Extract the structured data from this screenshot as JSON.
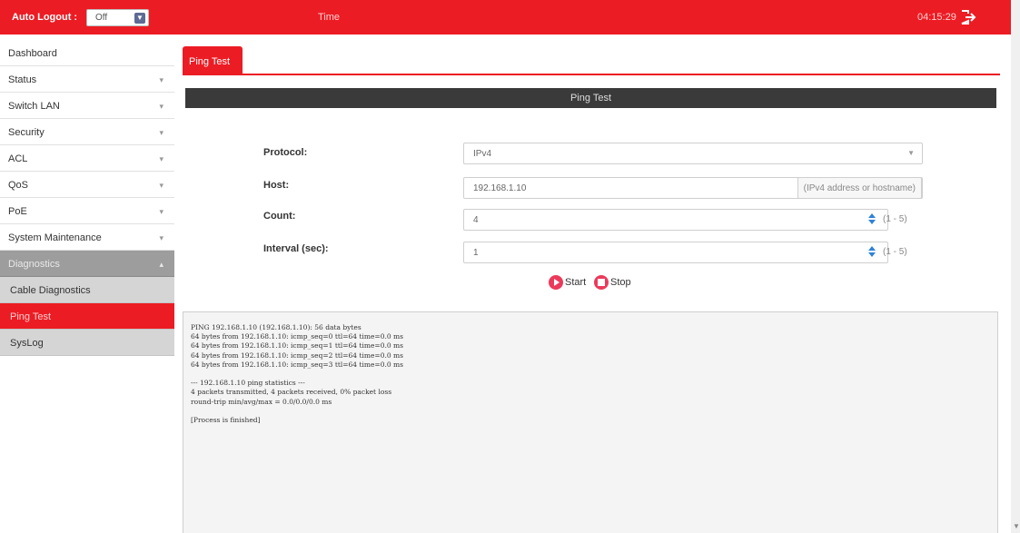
{
  "header": {
    "auto_logout_label": "Auto Logout :",
    "auto_logout_value": "Off",
    "time_label": "Time",
    "clock": "04:15:29",
    "logout_icon": "logout-icon",
    "brand_color": "#ec1c24"
  },
  "sidebar": {
    "items": [
      {
        "label": "Dashboard",
        "chevron": false
      },
      {
        "label": "Status",
        "chevron": true
      },
      {
        "label": "Switch LAN",
        "chevron": true
      },
      {
        "label": "Security",
        "chevron": true
      },
      {
        "label": "ACL",
        "chevron": true
      },
      {
        "label": "QoS",
        "chevron": true
      },
      {
        "label": "PoE",
        "chevron": true
      },
      {
        "label": "System Maintenance",
        "chevron": true
      }
    ],
    "diagnostics": {
      "label": "Diagnostics",
      "chevron": true
    },
    "sub_items": [
      {
        "label": "Cable Diagnostics",
        "active": false
      },
      {
        "label": "Ping Test",
        "active": true
      },
      {
        "label": "SysLog",
        "active": false
      }
    ]
  },
  "main": {
    "tab": "Ping Test",
    "section_title": "Ping Test",
    "form": {
      "protocol_label": "Protocol:",
      "protocol_value": "IPv4",
      "host_label": "Host:",
      "host_value": "192.168.1.10",
      "host_hint": "(IPv4 address or hostname)",
      "count_label": "Count:",
      "count_value": "4",
      "count_range": "(1 - 5)",
      "interval_label": "Interval (sec):",
      "interval_value": "1",
      "interval_range": "(1 - 5)"
    },
    "buttons": {
      "start": "Start",
      "stop": "Stop"
    },
    "output": [
      "PING 192.168.1.10 (192.168.1.10): 56 data bytes",
      "64 bytes from 192.168.1.10: icmp_seq=0 ttl=64 time=0.0 ms",
      "64 bytes from 192.168.1.10: icmp_seq=1 ttl=64 time=0.0 ms",
      "64 bytes from 192.168.1.10: icmp_seq=2 ttl=64 time=0.0 ms",
      "64 bytes from 192.168.1.10: icmp_seq=3 ttl=64 time=0.0 ms",
      "",
      "--- 192.168.1.10 ping statistics ---",
      "4 packets transmitted, 4 packets received, 0% packet loss",
      "round-trip min/avg/max = 0.0/0.0/0.0 ms",
      "",
      "[Process is finished]"
    ]
  }
}
